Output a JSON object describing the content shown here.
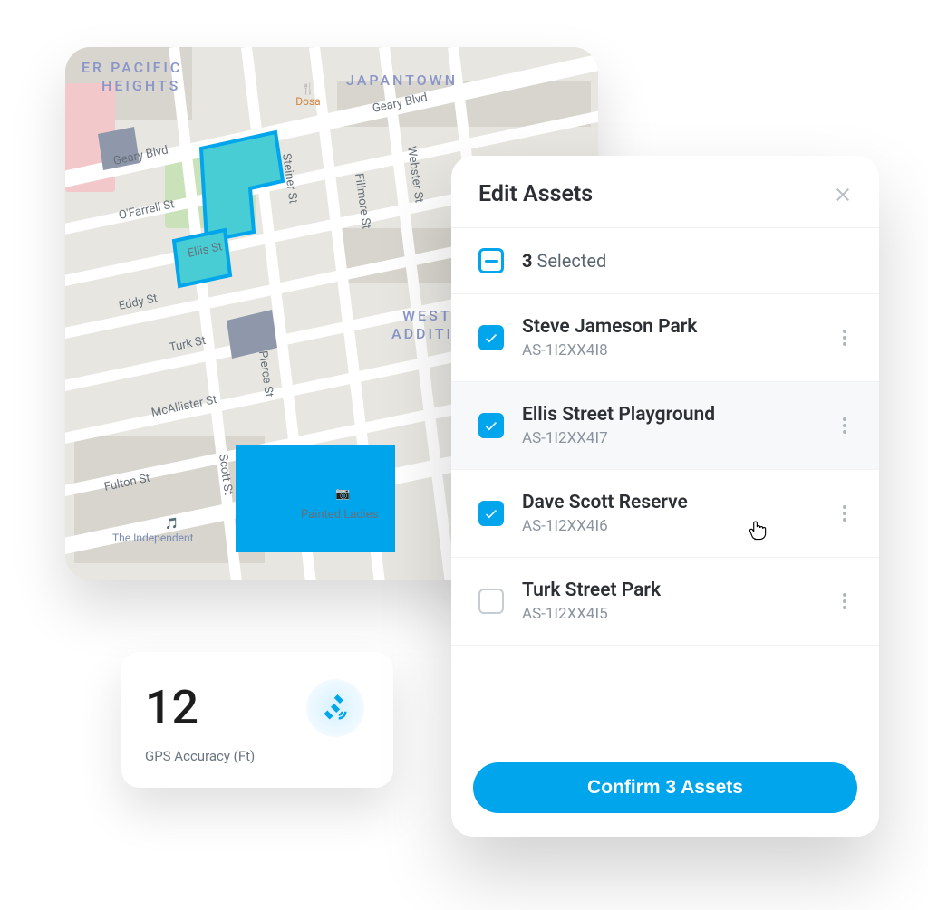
{
  "map": {
    "neighborhoods": {
      "pacific_heights_1": "ER PACIFIC",
      "pacific_heights_2": "HEIGHTS",
      "japantown": "JAPANTOWN",
      "west_add_1": "WEST",
      "west_add_2": "ADDITI"
    },
    "streets": {
      "geary_blvd_a": "Geary Blvd",
      "geary_blvd_b": "Geary Blvd",
      "ofarrell": "O'Farrell St",
      "ellis": "Ellis St",
      "eddy": "Eddy St",
      "turk": "Turk St",
      "mcallister": "McAllister St",
      "fulton": "Fulton St",
      "steiner": "Steiner St",
      "pierce": "Pierce St",
      "scott": "Scott St",
      "fillmore": "Fillmore St",
      "webster": "Webster St"
    },
    "poi": {
      "dosa": "Dosa",
      "painted_ladies": "Painted Ladies",
      "independent": "The Independent"
    }
  },
  "gps": {
    "value": "12",
    "label": "GPS Accuracy (Ft)"
  },
  "panel": {
    "title": "Edit Assets",
    "selected_count": "3",
    "selected_suffix": " Selected",
    "confirm_label": "Confirm 3 Assets"
  },
  "assets": [
    {
      "name": "Steve Jameson Park",
      "id": "AS-1I2XX4I8",
      "checked": true
    },
    {
      "name": "Ellis Street Playground",
      "id": "AS-1I2XX4I7",
      "checked": true
    },
    {
      "name": "Dave Scott Reserve",
      "id": "AS-1I2XX4I6",
      "checked": true
    },
    {
      "name": "Turk Street Park",
      "id": "AS-1I2XX4I5",
      "checked": false
    }
  ]
}
